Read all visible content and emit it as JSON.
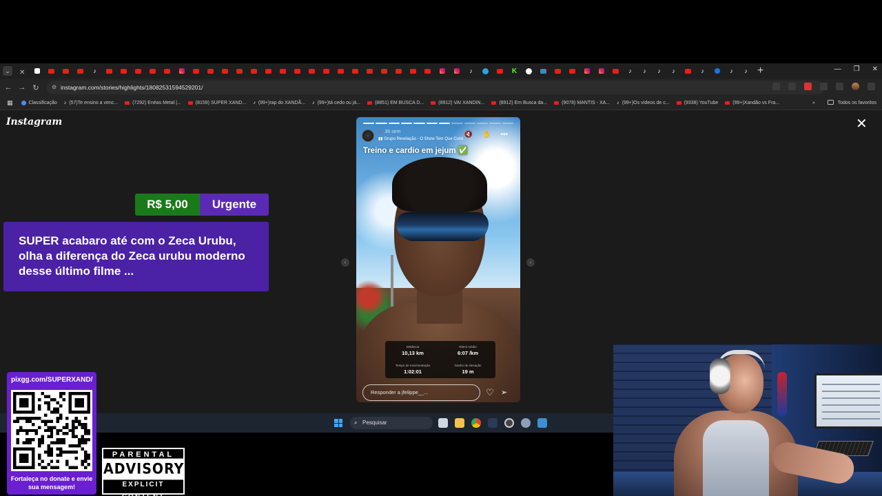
{
  "browser": {
    "url": "instagram.com/stories/highlights/18082531594529201/",
    "bookmarks": [
      {
        "icon": "classroom",
        "label": "Classificação"
      },
      {
        "icon": "tiktok",
        "label": "(57)Te ensino a venc..."
      },
      {
        "icon": "youtube",
        "label": "(7292) Enéas Metal |..."
      },
      {
        "icon": "youtube",
        "label": "(8159) SUPER XAND..."
      },
      {
        "icon": "tiktok",
        "label": "(99+)rap do XANDÃ..."
      },
      {
        "icon": "tiktok",
        "label": "(99+)tá cedo ou já..."
      },
      {
        "icon": "youtube",
        "label": "(8851) EM BUSCA D..."
      },
      {
        "icon": "youtube",
        "label": "(8912) VAI XANDIN..."
      },
      {
        "icon": "youtube",
        "label": "(8912) Em Busca da..."
      },
      {
        "icon": "youtube",
        "label": "(9078) MANTIS - XA..."
      },
      {
        "icon": "tiktok",
        "label": "(99+)Os vídeos de c..."
      },
      {
        "icon": "youtube",
        "label": "(9338) YouTube"
      },
      {
        "icon": "youtube",
        "label": "(99+)Xandão vs Fra..."
      }
    ],
    "all_bookmarks_label": "Todos os favoritos"
  },
  "instagram": {
    "logo": "Instagram",
    "story": {
      "time": "36 sem",
      "username": "x",
      "music": "Grupo Revelação · O Show Tem Que Conti",
      "caption": "Treino e cardio em jejum ✅",
      "progress_total": 12,
      "progress_done": 7,
      "stats": [
        {
          "label": "Distância",
          "value": "10,13 km"
        },
        {
          "label": "Ritmo médio",
          "value": "6:07 /km"
        },
        {
          "label": "Tempo de movimentação",
          "value": "1:02:01"
        },
        {
          "label": "Ganho de elevação",
          "value": "19 m"
        }
      ],
      "reply_placeholder": "Responder a jfelippe__..."
    }
  },
  "taskbar": {
    "search_placeholder": "Pesquisar"
  },
  "overlay": {
    "donation_amount": "R$ 5,00",
    "donation_tag": "Urgente",
    "donation_message": "SUPER acabaro até com o Zeca Urubu, olha a diferença do Zeca urubu moderno desse último filme ...",
    "qr_url": "pixgg.com/SUPERXAND/",
    "qr_caption": "Fortaleça no donate e envie sua mensagem!",
    "advisory_top": "PARENTAL",
    "advisory_mid": "ADVISORY",
    "advisory_bottom": "EXPLICIT CONTENT"
  }
}
